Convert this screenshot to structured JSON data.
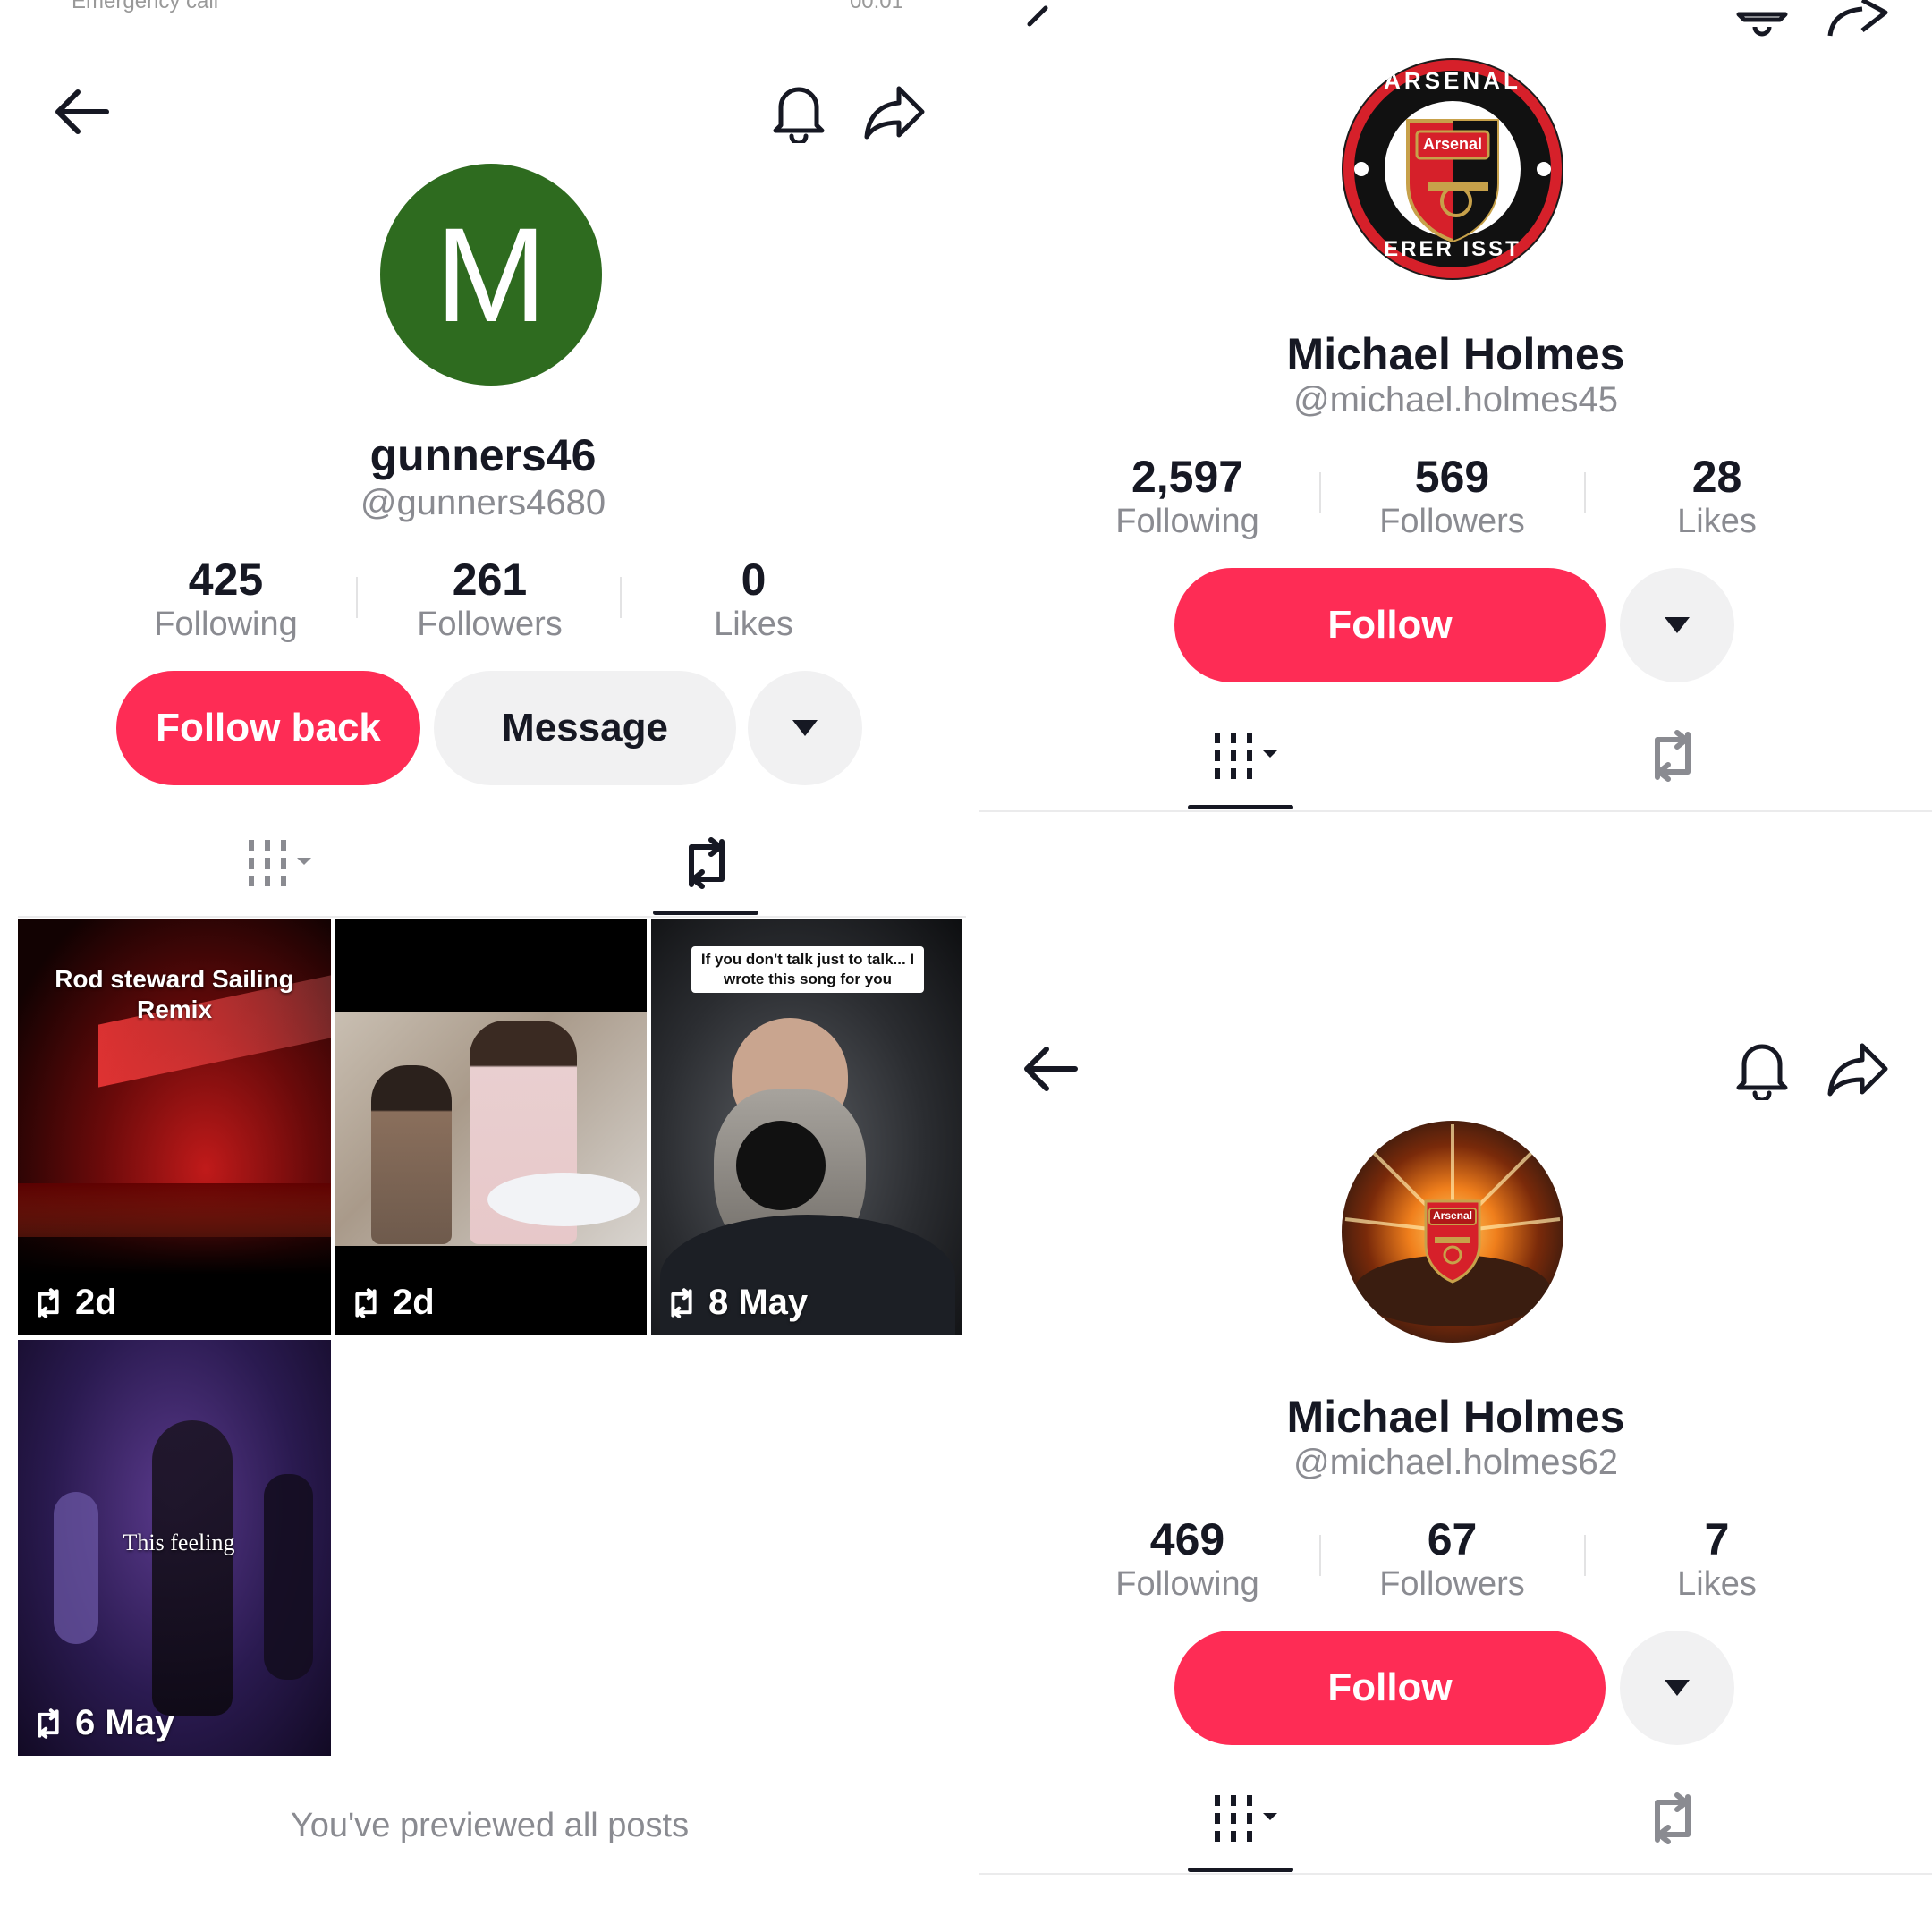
{
  "status_bar": {
    "left": "Emergency call",
    "right": "00:01"
  },
  "profile_main": {
    "avatar_letter": "M",
    "username": "gunners46",
    "handle": "@gunners4680",
    "stats": [
      {
        "value": "425",
        "label": "Following"
      },
      {
        "value": "261",
        "label": "Followers"
      },
      {
        "value": "0",
        "label": "Likes"
      }
    ],
    "buttons": {
      "follow_back": "Follow back",
      "message": "Message"
    },
    "active_tab": "reposts",
    "posts": [
      {
        "caption": "Rod steward Sailing Remix",
        "time": "2d"
      },
      {
        "caption": "",
        "time": "2d"
      },
      {
        "caption": "If you don't talk just to talk... I wrote this song for you",
        "time": "8 May"
      },
      {
        "caption": "This feeling",
        "time": "6 May"
      }
    ],
    "end_message": "You've previewed all posts"
  },
  "profile_top_right": {
    "name": "Michael Holmes",
    "handle": "@michael.holmes45",
    "crest_text_top": "ARSENAL",
    "crest_text_bottom": "ERER ISST",
    "crest_inner": "Arsenal",
    "stats": [
      {
        "value": "2,597",
        "label": "Following"
      },
      {
        "value": "569",
        "label": "Followers"
      },
      {
        "value": "28",
        "label": "Likes"
      }
    ],
    "follow_label": "Follow",
    "active_tab": "videos"
  },
  "profile_bottom_right": {
    "name": "Michael Holmes",
    "handle": "@michael.holmes62",
    "crest_inner": "Arsenal",
    "stats": [
      {
        "value": "469",
        "label": "Following"
      },
      {
        "value": "67",
        "label": "Followers"
      },
      {
        "value": "7",
        "label": "Likes"
      }
    ],
    "follow_label": "Follow",
    "active_tab": "videos"
  },
  "colors": {
    "accent": "#fe2c55",
    "avatar_green": "#2e6b1f",
    "text": "#161823",
    "muted": "#8a8b91"
  }
}
